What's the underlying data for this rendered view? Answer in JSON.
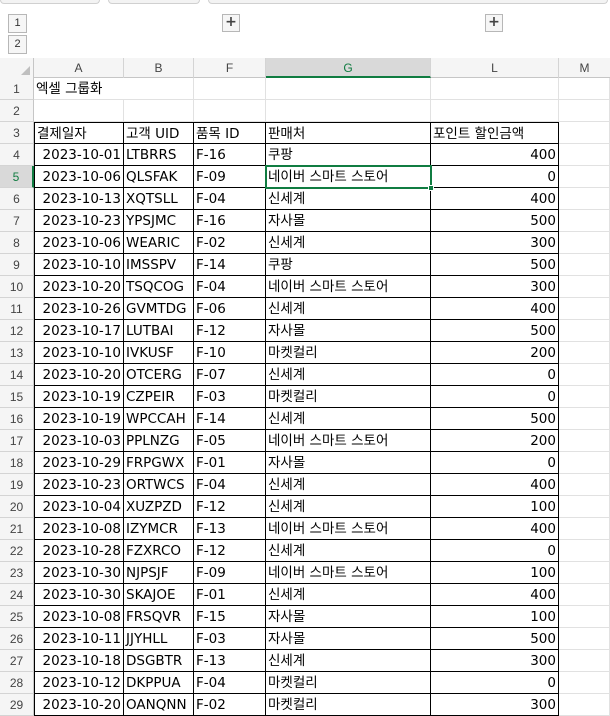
{
  "outline": {
    "levels": [
      "1",
      "2"
    ],
    "expand_buttons": [
      "+",
      "+"
    ]
  },
  "columns": [
    "A",
    "B",
    "F",
    "G",
    "L",
    "M"
  ],
  "active_column": "G",
  "active_row": "5",
  "rows": [
    "1",
    "2",
    "3",
    "4",
    "5",
    "6",
    "7",
    "8",
    "9",
    "10",
    "11",
    "12",
    "13",
    "14",
    "15",
    "16",
    "17",
    "18",
    "19",
    "20",
    "21",
    "22",
    "23",
    "24",
    "25",
    "26",
    "27",
    "28",
    "29"
  ],
  "sheet": {
    "title": "엑셀 그룹화",
    "headers": [
      "결제일자",
      "고객 UID",
      "품목 ID",
      "판매처",
      "포인트 할인금액"
    ],
    "records": [
      [
        "2023-10-01",
        "LTBRRS",
        "F-16",
        "쿠팡",
        "400"
      ],
      [
        "2023-10-06",
        "QLSFAK",
        "F-09",
        "네이버 스마트 스토어",
        "0"
      ],
      [
        "2023-10-13",
        "XQTSLL",
        "F-04",
        "신세계",
        "400"
      ],
      [
        "2023-10-23",
        "YPSJMC",
        "F-16",
        "자사몰",
        "500"
      ],
      [
        "2023-10-06",
        "WEARIC",
        "F-02",
        "신세계",
        "300"
      ],
      [
        "2023-10-10",
        "IMSSPV",
        "F-14",
        "쿠팡",
        "500"
      ],
      [
        "2023-10-20",
        "TSQCOG",
        "F-04",
        "네이버 스마트 스토어",
        "300"
      ],
      [
        "2023-10-26",
        "GVMTDG",
        "F-06",
        "신세계",
        "400"
      ],
      [
        "2023-10-17",
        "LUTBAI",
        "F-12",
        "자사몰",
        "500"
      ],
      [
        "2023-10-10",
        "IVKUSF",
        "F-10",
        "마켓컬리",
        "200"
      ],
      [
        "2023-10-20",
        "OTCERG",
        "F-07",
        "신세계",
        "0"
      ],
      [
        "2023-10-19",
        "CZPEIR",
        "F-03",
        "마켓컬리",
        "0"
      ],
      [
        "2023-10-19",
        "WPCCAH",
        "F-14",
        "신세계",
        "500"
      ],
      [
        "2023-10-03",
        "PPLNZG",
        "F-05",
        "네이버 스마트 스토어",
        "200"
      ],
      [
        "2023-10-29",
        "FRPGWX",
        "F-01",
        "자사몰",
        "0"
      ],
      [
        "2023-10-23",
        "ORTWCS",
        "F-04",
        "신세계",
        "400"
      ],
      [
        "2023-10-04",
        "XUZPZD",
        "F-12",
        "신세계",
        "100"
      ],
      [
        "2023-10-08",
        "IZYMCR",
        "F-13",
        "네이버 스마트 스토어",
        "400"
      ],
      [
        "2023-10-28",
        "FZXRCO",
        "F-12",
        "신세계",
        "0"
      ],
      [
        "2023-10-30",
        "NJPSJF",
        "F-09",
        "네이버 스마트 스토어",
        "100"
      ],
      [
        "2023-10-30",
        "SKAJOE",
        "F-01",
        "신세계",
        "400"
      ],
      [
        "2023-10-08",
        "FRSQVR",
        "F-15",
        "자사몰",
        "100"
      ],
      [
        "2023-10-11",
        "JJYHLL",
        "F-03",
        "자사몰",
        "500"
      ],
      [
        "2023-10-18",
        "DSGBTR",
        "F-13",
        "신세계",
        "300"
      ],
      [
        "2023-10-12",
        "DKPPUA",
        "F-04",
        "마켓컬리",
        "0"
      ],
      [
        "2023-10-20",
        "OANQNN",
        "F-02",
        "마켓컬리",
        "300"
      ]
    ]
  },
  "colors": {
    "accent": "#107c41",
    "header_bg": "#f5f5f5",
    "grid_line": "#e1e1e1"
  }
}
